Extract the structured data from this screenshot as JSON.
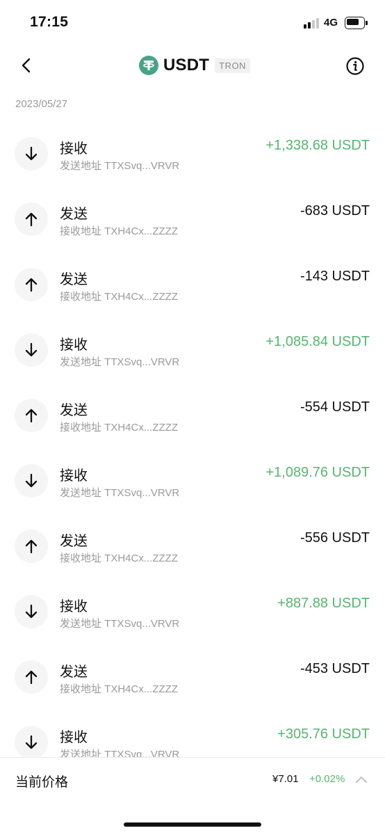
{
  "status_bar": {
    "time": "17:15",
    "network": "4G"
  },
  "header": {
    "title": "USDT",
    "chain": "TRON",
    "back_icon": "chevron-left-icon",
    "info_icon": "info-circle-icon"
  },
  "date": "2023/05/27",
  "transactions": [
    {
      "type": "接收",
      "address": "发送地址 TTXSvq...VRVR",
      "amount": "+1,338.68 USDT",
      "direction": "in"
    },
    {
      "type": "发送",
      "address": "接收地址 TXH4Cx...ZZZZ",
      "amount": "-683 USDT",
      "direction": "out"
    },
    {
      "type": "发送",
      "address": "接收地址 TXH4Cx...ZZZZ",
      "amount": "-143 USDT",
      "direction": "out"
    },
    {
      "type": "接收",
      "address": "发送地址 TTXSvq...VRVR",
      "amount": "+1,085.84 USDT",
      "direction": "in"
    },
    {
      "type": "发送",
      "address": "接收地址 TXH4Cx...ZZZZ",
      "amount": "-554 USDT",
      "direction": "out"
    },
    {
      "type": "接收",
      "address": "发送地址 TTXSvq...VRVR",
      "amount": "+1,089.76 USDT",
      "direction": "in"
    },
    {
      "type": "发送",
      "address": "接收地址 TXH4Cx...ZZZZ",
      "amount": "-556 USDT",
      "direction": "out"
    },
    {
      "type": "接收",
      "address": "发送地址 TTXSvq...VRVR",
      "amount": "+887.88 USDT",
      "direction": "in"
    },
    {
      "type": "发送",
      "address": "接收地址 TXH4Cx...ZZZZ",
      "amount": "-453 USDT",
      "direction": "out"
    },
    {
      "type": "接收",
      "address": "发送地址 TTXSvq...VRVR",
      "amount": "+305.76 USDT",
      "direction": "in"
    }
  ],
  "footer": {
    "price_label": "当前价格",
    "price": "¥7.01",
    "change": "+0.02%"
  },
  "colors": {
    "positive": "#55b670",
    "token": "#4aa388",
    "muted": "#9a9a9a"
  }
}
